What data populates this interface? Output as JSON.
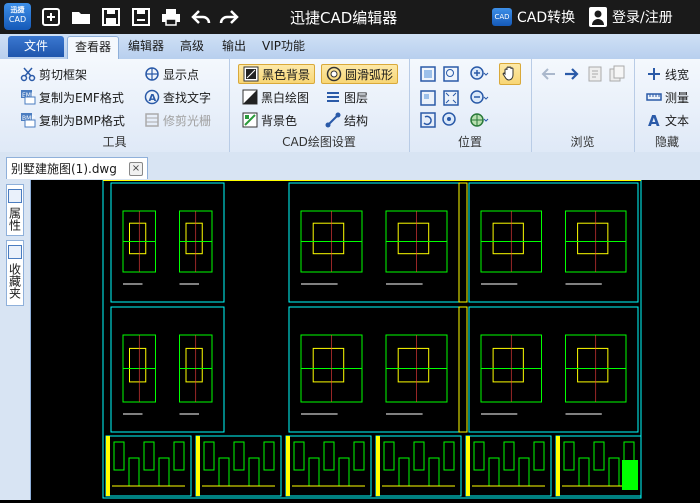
{
  "titlebar": {
    "logo_small": "迅捷",
    "logo_text": "CAD",
    "title": "迅捷CAD编辑器",
    "convert_icon": "CAD",
    "convert_label": "CAD转换",
    "login_label": "登录/注册"
  },
  "menu": {
    "file": "文件",
    "tabs": [
      "查看器",
      "编辑器",
      "高级",
      "输出",
      "VIP功能"
    ]
  },
  "ribbon": {
    "tools": {
      "label": "工具",
      "items": [
        "剪切框架",
        "复制为EMF格式",
        "复制为BMP格式",
        "显示点",
        "查找文字",
        "修剪光栅"
      ]
    },
    "cad_settings": {
      "label": "CAD绘图设置",
      "items": [
        "黑色背景",
        "黑白绘图",
        "背景色",
        "圆滑弧形",
        "图层",
        "结构"
      ]
    },
    "position": {
      "label": "位置"
    },
    "browse": {
      "label": "浏览"
    },
    "hide": {
      "label": "隐藏",
      "items": [
        "线宽",
        "测量",
        "文本"
      ]
    }
  },
  "document": {
    "tab_name": "别墅建施图(1).dwg",
    "close": "×"
  },
  "side_panel": {
    "tabs": [
      "属性",
      "收藏夹"
    ]
  },
  "colors": {
    "drawing_frame": "#00ffff",
    "drawing_green": "#00ff00",
    "drawing_yellow": "#ffff00",
    "accent": "#1f56ad"
  }
}
